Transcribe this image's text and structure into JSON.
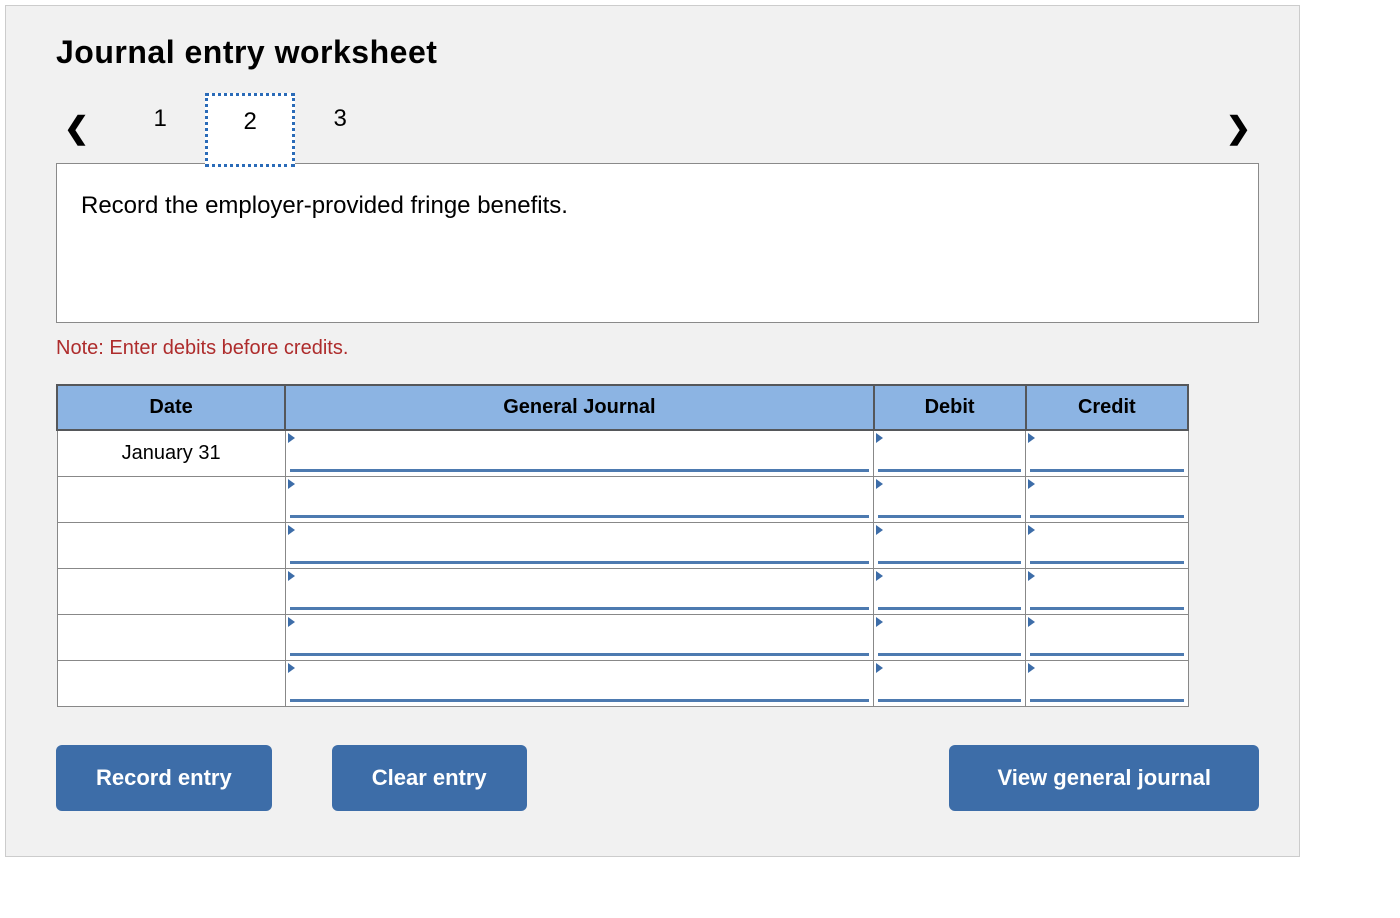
{
  "title": "Journal entry worksheet",
  "nav": {
    "prev_glyph": "‹",
    "next_glyph": "›",
    "steps": [
      "1",
      "2",
      "3"
    ],
    "active_index": 1
  },
  "description": "Record the employer-provided fringe benefits.",
  "note": "Note: Enter debits before credits.",
  "table": {
    "headers": {
      "date": "Date",
      "general_journal": "General Journal",
      "debit": "Debit",
      "credit": "Credit"
    },
    "rows": [
      {
        "date": "January 31",
        "gj": "",
        "debit": "",
        "credit": ""
      },
      {
        "date": "",
        "gj": "",
        "debit": "",
        "credit": ""
      },
      {
        "date": "",
        "gj": "",
        "debit": "",
        "credit": ""
      },
      {
        "date": "",
        "gj": "",
        "debit": "",
        "credit": ""
      },
      {
        "date": "",
        "gj": "",
        "debit": "",
        "credit": ""
      },
      {
        "date": "",
        "gj": "",
        "debit": "",
        "credit": ""
      }
    ]
  },
  "buttons": {
    "record": "Record entry",
    "clear": "Clear entry",
    "view": "View general journal"
  }
}
